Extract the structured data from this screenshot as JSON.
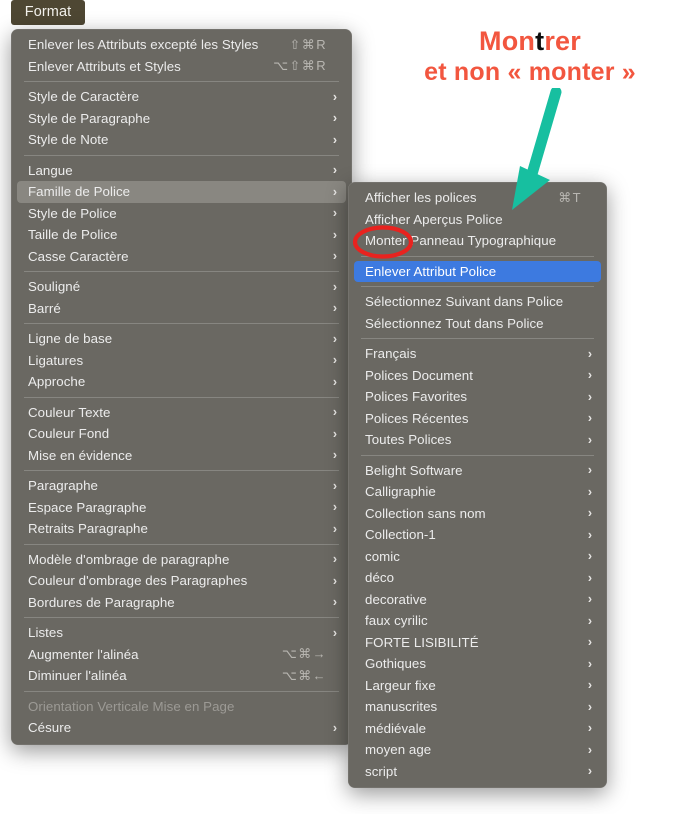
{
  "menubar": {
    "title": "Format"
  },
  "colors": {
    "menu_bg": "#6a6862",
    "menubar_highlight": "#4e4733",
    "row_highlight_gray": "#898781",
    "row_highlight_blue": "#3d7ae0",
    "annotation_red": "#f2563f",
    "annotation_emphasis": "#0d0d0d",
    "arrow_teal": "#17bfa0",
    "circle_red": "#e8231f"
  },
  "format_menu": {
    "name": "Format",
    "groups": [
      {
        "items": [
          {
            "label": "Enlever les Attributs excepté les Styles",
            "shortcut": "⇧⌘R",
            "submenu": false,
            "disabled": false,
            "highlight": "none"
          },
          {
            "label": "Enlever Attributs et Styles",
            "shortcut": "⌥⇧⌘R",
            "submenu": false,
            "disabled": false,
            "highlight": "none"
          }
        ]
      },
      {
        "items": [
          {
            "label": "Style de Caractère",
            "shortcut": "",
            "submenu": true,
            "disabled": false,
            "highlight": "none"
          },
          {
            "label": "Style de Paragraphe",
            "shortcut": "",
            "submenu": true,
            "disabled": false,
            "highlight": "none"
          },
          {
            "label": "Style de Note",
            "shortcut": "",
            "submenu": true,
            "disabled": false,
            "highlight": "none"
          }
        ]
      },
      {
        "items": [
          {
            "label": "Langue",
            "shortcut": "",
            "submenu": true,
            "disabled": false,
            "highlight": "none"
          },
          {
            "label": "Famille de Police",
            "shortcut": "",
            "submenu": true,
            "disabled": false,
            "highlight": "gray"
          },
          {
            "label": "Style de Police",
            "shortcut": "",
            "submenu": true,
            "disabled": false,
            "highlight": "none"
          },
          {
            "label": "Taille de Police",
            "shortcut": "",
            "submenu": true,
            "disabled": false,
            "highlight": "none"
          },
          {
            "label": "Casse Caractère",
            "shortcut": "",
            "submenu": true,
            "disabled": false,
            "highlight": "none"
          }
        ]
      },
      {
        "items": [
          {
            "label": "Souligné",
            "shortcut": "",
            "submenu": true,
            "disabled": false,
            "highlight": "none"
          },
          {
            "label": "Barré",
            "shortcut": "",
            "submenu": true,
            "disabled": false,
            "highlight": "none"
          }
        ]
      },
      {
        "items": [
          {
            "label": "Ligne de base",
            "shortcut": "",
            "submenu": true,
            "disabled": false,
            "highlight": "none"
          },
          {
            "label": "Ligatures",
            "shortcut": "",
            "submenu": true,
            "disabled": false,
            "highlight": "none"
          },
          {
            "label": "Approche",
            "shortcut": "",
            "submenu": true,
            "disabled": false,
            "highlight": "none"
          }
        ]
      },
      {
        "items": [
          {
            "label": "Couleur Texte",
            "shortcut": "",
            "submenu": true,
            "disabled": false,
            "highlight": "none"
          },
          {
            "label": "Couleur Fond",
            "shortcut": "",
            "submenu": true,
            "disabled": false,
            "highlight": "none"
          },
          {
            "label": "Mise en évidence",
            "shortcut": "",
            "submenu": true,
            "disabled": false,
            "highlight": "none"
          }
        ]
      },
      {
        "items": [
          {
            "label": "Paragraphe",
            "shortcut": "",
            "submenu": true,
            "disabled": false,
            "highlight": "none"
          },
          {
            "label": "Espace Paragraphe",
            "shortcut": "",
            "submenu": true,
            "disabled": false,
            "highlight": "none"
          },
          {
            "label": "Retraits Paragraphe",
            "shortcut": "",
            "submenu": true,
            "disabled": false,
            "highlight": "none"
          }
        ]
      },
      {
        "items": [
          {
            "label": "Modèle d'ombrage de paragraphe",
            "shortcut": "",
            "submenu": true,
            "disabled": false,
            "highlight": "none"
          },
          {
            "label": "Couleur d'ombrage des Paragraphes",
            "shortcut": "",
            "submenu": true,
            "disabled": false,
            "highlight": "none"
          },
          {
            "label": "Bordures de Paragraphe",
            "shortcut": "",
            "submenu": true,
            "disabled": false,
            "highlight": "none"
          }
        ]
      },
      {
        "items": [
          {
            "label": "Listes",
            "shortcut": "",
            "submenu": true,
            "disabled": false,
            "highlight": "none"
          },
          {
            "label": "Augmenter l'alinéa",
            "shortcut": "⌥⌘→",
            "submenu": false,
            "disabled": false,
            "highlight": "none"
          },
          {
            "label": "Diminuer l'alinéa",
            "shortcut": "⌥⌘←",
            "submenu": false,
            "disabled": false,
            "highlight": "none"
          }
        ]
      },
      {
        "items": [
          {
            "label": "Orientation Verticale Mise en Page",
            "shortcut": "",
            "submenu": false,
            "disabled": true,
            "highlight": "none"
          },
          {
            "label": "Césure",
            "shortcut": "",
            "submenu": true,
            "disabled": false,
            "highlight": "none"
          }
        ]
      }
    ]
  },
  "fontfamily_menu": {
    "name": "Famille de Police",
    "groups": [
      {
        "items": [
          {
            "label": "Afficher les polices",
            "shortcut": "⌘T",
            "submenu": false,
            "disabled": false,
            "highlight": "none"
          },
          {
            "label": "Afficher Aperçus Police",
            "shortcut": "",
            "submenu": false,
            "disabled": false,
            "highlight": "none"
          },
          {
            "label": "Monter Panneau Typographique",
            "shortcut": "",
            "submenu": false,
            "disabled": false,
            "highlight": "none"
          }
        ]
      },
      {
        "items": [
          {
            "label": "Enlever Attribut Police",
            "shortcut": "",
            "submenu": false,
            "disabled": false,
            "highlight": "blue"
          }
        ]
      },
      {
        "items": [
          {
            "label": "Sélectionnez Suivant dans Police",
            "shortcut": "",
            "submenu": false,
            "disabled": false,
            "highlight": "none"
          },
          {
            "label": "Sélectionnez Tout dans Police",
            "shortcut": "",
            "submenu": false,
            "disabled": false,
            "highlight": "none"
          }
        ]
      },
      {
        "items": [
          {
            "label": "Français",
            "shortcut": "",
            "submenu": true,
            "disabled": false,
            "highlight": "none"
          },
          {
            "label": "Polices Document",
            "shortcut": "",
            "submenu": true,
            "disabled": false,
            "highlight": "none"
          },
          {
            "label": "Polices Favorites",
            "shortcut": "",
            "submenu": true,
            "disabled": false,
            "highlight": "none"
          },
          {
            "label": "Polices Récentes",
            "shortcut": "",
            "submenu": true,
            "disabled": false,
            "highlight": "none"
          },
          {
            "label": "Toutes Polices",
            "shortcut": "",
            "submenu": true,
            "disabled": false,
            "highlight": "none"
          }
        ]
      },
      {
        "items": [
          {
            "label": "Belight Software",
            "shortcut": "",
            "submenu": true,
            "disabled": false,
            "highlight": "none"
          },
          {
            "label": "Calligraphie",
            "shortcut": "",
            "submenu": true,
            "disabled": false,
            "highlight": "none"
          },
          {
            "label": "Collection sans nom",
            "shortcut": "",
            "submenu": true,
            "disabled": false,
            "highlight": "none"
          },
          {
            "label": "Collection-1",
            "shortcut": "",
            "submenu": true,
            "disabled": false,
            "highlight": "none"
          },
          {
            "label": "comic",
            "shortcut": "",
            "submenu": true,
            "disabled": false,
            "highlight": "none"
          },
          {
            "label": "déco",
            "shortcut": "",
            "submenu": true,
            "disabled": false,
            "highlight": "none"
          },
          {
            "label": "decorative",
            "shortcut": "",
            "submenu": true,
            "disabled": false,
            "highlight": "none"
          },
          {
            "label": "faux cyrilic",
            "shortcut": "",
            "submenu": true,
            "disabled": false,
            "highlight": "none"
          },
          {
            "label": "FORTE LISIBILITÉ",
            "shortcut": "",
            "submenu": true,
            "disabled": false,
            "highlight": "none"
          },
          {
            "label": "Gothiques",
            "shortcut": "",
            "submenu": true,
            "disabled": false,
            "highlight": "none"
          },
          {
            "label": "Largeur fixe",
            "shortcut": "",
            "submenu": true,
            "disabled": false,
            "highlight": "none"
          },
          {
            "label": "manuscrites",
            "shortcut": "",
            "submenu": true,
            "disabled": false,
            "highlight": "none"
          },
          {
            "label": "médiévale",
            "shortcut": "",
            "submenu": true,
            "disabled": false,
            "highlight": "none"
          },
          {
            "label": "moyen age",
            "shortcut": "",
            "submenu": true,
            "disabled": false,
            "highlight": "none"
          },
          {
            "label": "script",
            "shortcut": "",
            "submenu": true,
            "disabled": false,
            "highlight": "none"
          }
        ]
      }
    ]
  },
  "annotation": {
    "line1_before": "Mon",
    "line1_emphasis": "t",
    "line1_after": "rer",
    "line2": "et non « monter »",
    "arrow": "down-left-arrow",
    "circled_item": "Monter"
  }
}
